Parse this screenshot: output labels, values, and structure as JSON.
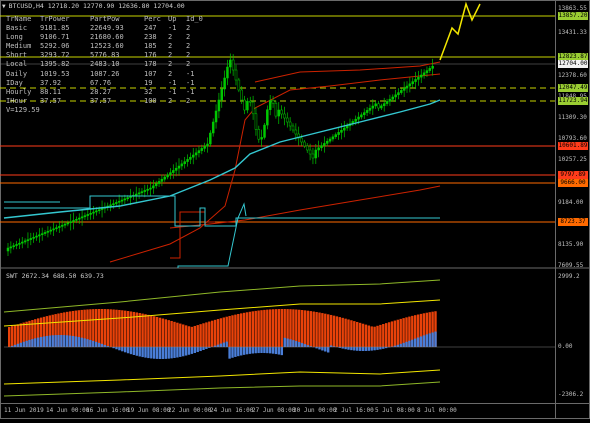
{
  "window": {
    "symbol_line": "BTCUSD,H4  12718.20 12770.90 12636.80 12704.00"
  },
  "info_table": {
    "columns": [
      "TrName",
      "TrPower",
      "PartPow",
      "Perc",
      "Up",
      "Id_0"
    ],
    "rows": [
      {
        "name": "Basic",
        "trpower": "9181.85",
        "partpow": "22649.93",
        "perc": "247",
        "up": "-1",
        "id0": "2"
      },
      {
        "name": "Long",
        "trpower": "9106.71",
        "partpow": "21680.60",
        "perc": "238",
        "up": "2",
        "id0": "2"
      },
      {
        "name": "Medium",
        "trpower": "5292.06",
        "partpow": "12523.60",
        "perc": "185",
        "up": "2",
        "id0": "2"
      },
      {
        "name": "Short",
        "trpower": "3293.72",
        "partpow": "5776.83",
        "perc": "176",
        "up": "2",
        "id0": "2"
      },
      {
        "name": "Local",
        "trpower": "1395.82",
        "partpow": "2483.10",
        "perc": "178",
        "up": "2",
        "id0": "2"
      },
      {
        "name": "Daily",
        "trpower": "1019.53",
        "partpow": "1087.26",
        "perc": "107",
        "up": "2",
        "id0": "-1"
      },
      {
        "name": "IDay",
        "trpower": "37.92",
        "partpow": "67.76",
        "perc": "19",
        "up": "-1",
        "id0": "-1"
      },
      {
        "name": "Hourly",
        "trpower": "88.11",
        "partpow": "28.27",
        "perc": "32",
        "up": "-1",
        "id0": "-1"
      },
      {
        "name": "IHour",
        "trpower": "37.57",
        "partpow": "37.57",
        "perc": "100",
        "up": "2",
        "id0": "2"
      }
    ],
    "footer": "V=129.59"
  },
  "price_axis": {
    "ticks": [
      "13863.55",
      "13431.33",
      "12378.60",
      "11848.95",
      "11309.30",
      "10793.60",
      "10257.25",
      "9184.00",
      "8669.00",
      "8135.90",
      "7609.55"
    ],
    "badges": [
      {
        "label": "13857.20",
        "color": "#9acd32"
      },
      {
        "label": "12823.87",
        "color": "#9acd32"
      },
      {
        "label": "12704.00",
        "color": "#f2f2f2"
      },
      {
        "label": "12047.49",
        "color": "#9acd32"
      },
      {
        "label": "11723.94",
        "color": "#9acd32"
      },
      {
        "label": "10601.89",
        "color": "#ff3b1a"
      },
      {
        "label": "9797.89",
        "color": "#ff3b1a"
      },
      {
        "label": "9666.00",
        "color": "#ff6a00"
      },
      {
        "label": "8723.37",
        "color": "#ff6a00"
      }
    ]
  },
  "oscillator": {
    "header": "SWT 2672.34 688.50 639.73",
    "ticks": [
      "2999.2",
      "0.00",
      "-2306.2"
    ]
  },
  "time_axis": {
    "labels": [
      "11 Jun 2019",
      "14 Jun 00:00",
      "16 Jun 16:00",
      "19 Jun 08:00",
      "22 Jun 00:00",
      "24 Jun 16:00",
      "27 Jun 08:00",
      "30 Jun 00:00",
      "2 Jul 16:00",
      "5 Jul 08:00",
      "8 Jul 00:00"
    ]
  },
  "colors": {
    "background": "#000000",
    "bull_candle": "#00c800",
    "bear_candle": "#000000",
    "cyan_ma": "#34c7d0",
    "red_line": "#cc2200",
    "yellow_level": "#c8d400",
    "osc_blue": "#4a7ed8",
    "osc_orange": "#e8420a"
  }
}
